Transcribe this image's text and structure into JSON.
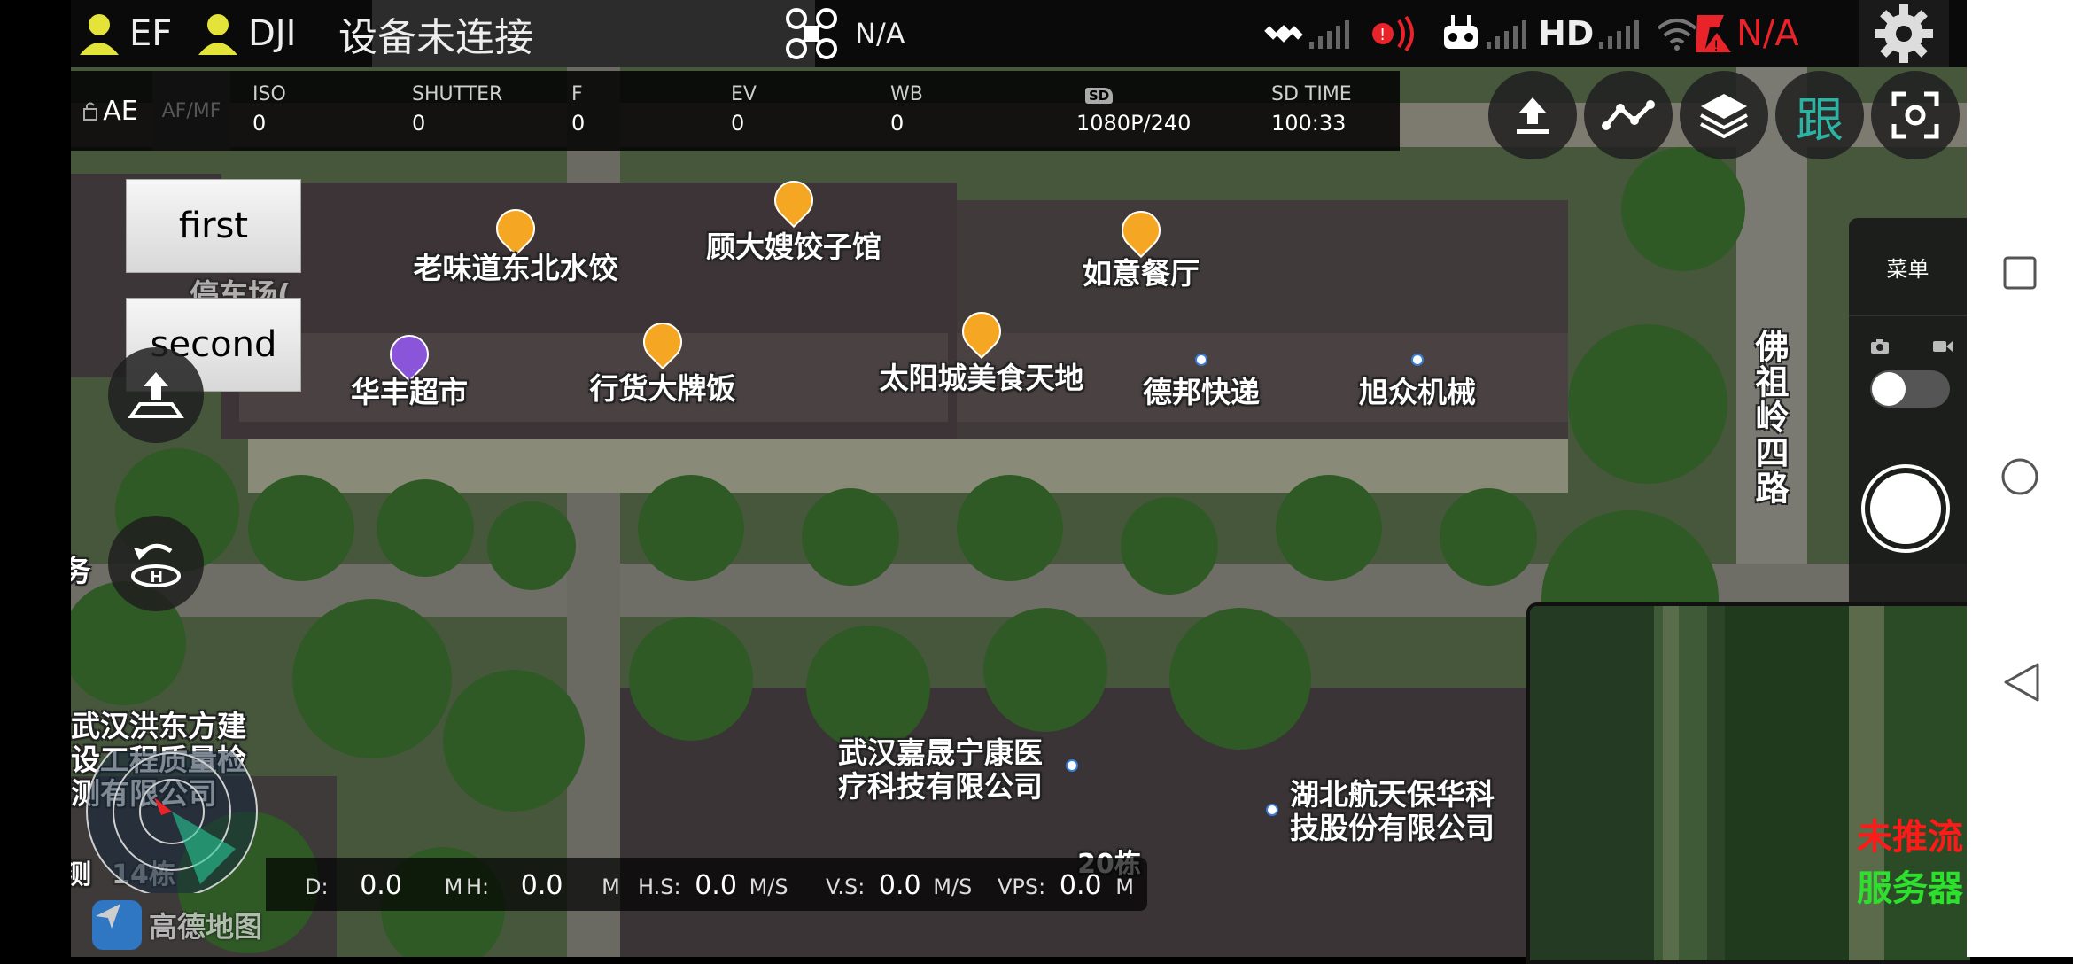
{
  "top_bar": {
    "user1": "EF",
    "user2": "DJI",
    "connection_status": "设备未连接",
    "drone_status": "N/A",
    "hd_label": "HD",
    "alert_status": "N/A"
  },
  "camera_params": {
    "ae_label": "AE",
    "afmf_label": "AF/MF",
    "iso_label": "ISO",
    "iso_value": "0",
    "shutter_label": "SHUTTER",
    "shutter_value": "0",
    "f_label": "F",
    "f_value": "0",
    "ev_label": "EV",
    "ev_value": "0",
    "wb_label": "WB",
    "wb_value": "0",
    "sd_label": "SD",
    "resolution": "1080P/240",
    "sd_time_label": "SD TIME",
    "sd_time_value": "100:33"
  },
  "toolbar": {
    "follow_label": "跟"
  },
  "left_buttons": {
    "first": "first",
    "second": "second"
  },
  "right_panel": {
    "menu_label": "菜单"
  },
  "map_labels": {
    "poi_1": "老味道东北水饺",
    "poi_2": "顾大嫂饺子馆",
    "poi_3": "如意餐厅",
    "poi_4": "华丰超市",
    "poi_5": "行货大牌饭",
    "poi_6": "太阳城美食天地",
    "poi_7": "德邦快递",
    "poi_8": "旭众机械",
    "poi_9": "武汉嘉晟宁康医\n疗科技有限公司",
    "poi_10": "湖北航天保华科\n技股份有限公司",
    "poi_11": "武汉洪东方建\n设工程质量检\n测有限公司",
    "poi_12": "停车场(\n出入口)",
    "road": "佛祖岭四路",
    "building_20": "20栋",
    "building_14": "14栋",
    "left_edge_char": "务",
    "left_edge_char2": "测",
    "attribution": "高德地图"
  },
  "telemetry": {
    "d_label": "D:",
    "d_value": "0.0",
    "d_unit": "M",
    "h_label": "H:",
    "h_value": "0.0",
    "h_unit": "M",
    "hs_label": "H.S:",
    "hs_value": "0.0",
    "hs_unit": "M/S",
    "vs_label": "V.S:",
    "vs_value": "0.0",
    "vs_unit": "M/S",
    "vps_label": "VPS:",
    "vps_value": "0.0",
    "vps_unit": "M"
  },
  "stream": {
    "status": "未推流",
    "server": "服务器"
  },
  "colors": {
    "accent_orange": "#f5a623",
    "alert_red": "#e8232a",
    "follow_teal": "#2bb3a3",
    "stream_red": "#ff1a1a",
    "stream_green": "#2de02d"
  }
}
